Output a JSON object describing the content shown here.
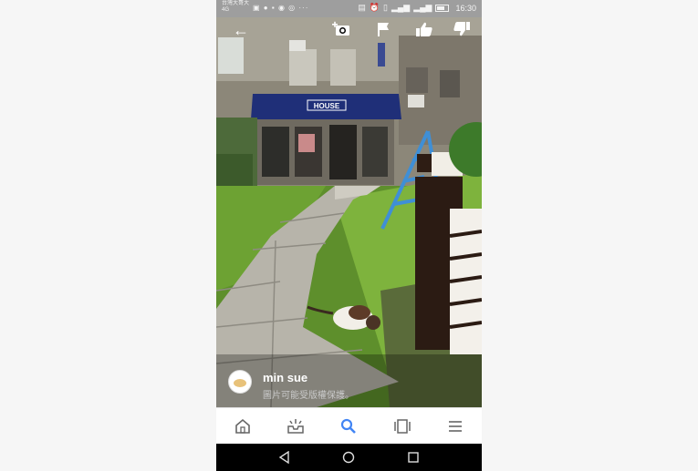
{
  "status_bar": {
    "carrier_line1": "台灣大哥大",
    "carrier_line2": "4G",
    "time": "16:30",
    "icons": [
      "image-icon",
      "chat-icon",
      "message-icon",
      "record-icon",
      "location-icon",
      "dots-icon",
      "nfc-icon",
      "alarm-icon",
      "vibrate-icon",
      "signal-icon",
      "wifi-icon",
      "battery-icon"
    ]
  },
  "viewer": {
    "store_sign": "HOUSE",
    "icons": [
      "back-arrow-icon",
      "add-photo-icon",
      "flag-icon",
      "thumbs-up-icon",
      "thumbs-down-icon"
    ]
  },
  "caption": {
    "author": "min sue",
    "notice": "圖片可能受版權保護。"
  },
  "bottom_nav": {
    "items": [
      "explore-icon",
      "updates-icon",
      "search-icon",
      "collections-icon",
      "menu-icon"
    ],
    "active": "search-icon",
    "active_color": "#4285f4",
    "inactive_color": "#666666"
  },
  "system_nav": [
    "back-triangle-icon",
    "home-circle-icon",
    "recents-square-icon"
  ]
}
